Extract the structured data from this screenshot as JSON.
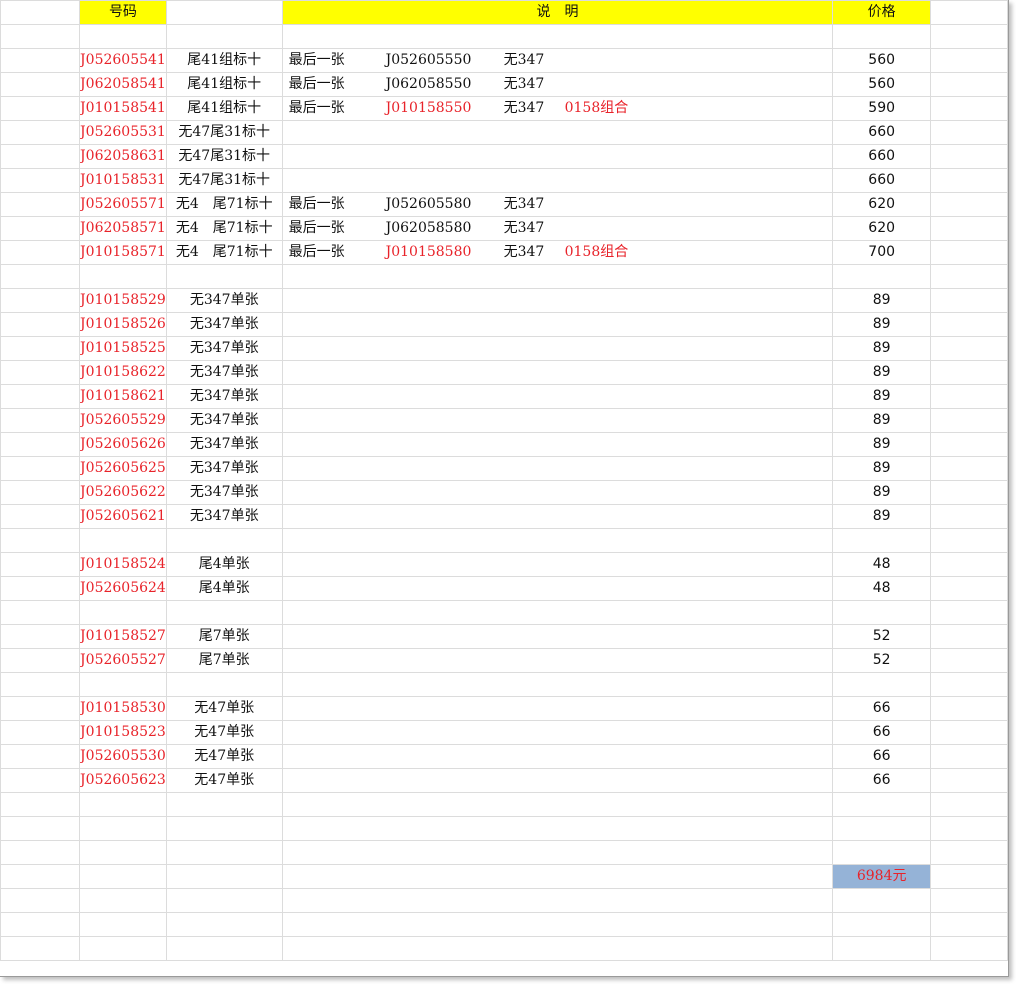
{
  "headers": {
    "code": "号码",
    "note": "说　明",
    "price": "价格"
  },
  "rows": [
    {
      "type": "blank"
    },
    {
      "type": "item",
      "code": "J052605541",
      "desc": "尾41组标十",
      "note1": "最后一张",
      "note2": "J052605550",
      "note3": "无347",
      "price": "560"
    },
    {
      "type": "item",
      "code": "J062058541",
      "desc": "尾41组标十",
      "note1": "最后一张",
      "note2": "J062058550",
      "note3": "无347",
      "price": "560"
    },
    {
      "type": "item",
      "code": "J010158541",
      "desc": "尾41组标十",
      "note1": "最后一张",
      "note2": "J010158550",
      "note3": "无347",
      "note4": "0158组合",
      "note2_red": true,
      "price": "590"
    },
    {
      "type": "item",
      "code": "J052605531",
      "desc": "无47尾31标十",
      "price": "660"
    },
    {
      "type": "item",
      "code": "J062058631",
      "desc": "无47尾31标十",
      "price": "660"
    },
    {
      "type": "item",
      "code": "J010158531",
      "desc": "无47尾31标十",
      "price": "660"
    },
    {
      "type": "item",
      "code": "J052605571",
      "desc": "无4　尾71标十",
      "note1": "最后一张",
      "note2": "J052605580",
      "note3": "无347",
      "price": "620"
    },
    {
      "type": "item",
      "code": "J062058571",
      "desc": "无4　尾71标十",
      "note1": "最后一张",
      "note2": "J062058580",
      "note3": "无347",
      "price": "620"
    },
    {
      "type": "item",
      "code": "J010158571",
      "desc": "无4　尾71标十",
      "note1": "最后一张",
      "note2": "J010158580",
      "note3": "无347",
      "note4": "0158组合",
      "note2_red": true,
      "price": "700"
    },
    {
      "type": "blank"
    },
    {
      "type": "item",
      "code": "J010158529",
      "desc": "无347单张",
      "price": "89"
    },
    {
      "type": "item",
      "code": "J010158526",
      "desc": "无347单张",
      "price": "89"
    },
    {
      "type": "item",
      "code": "J010158525",
      "desc": "无347单张",
      "price": "89"
    },
    {
      "type": "item",
      "code": "J010158622",
      "desc": "无347单张",
      "price": "89"
    },
    {
      "type": "item",
      "code": "J010158621",
      "desc": "无347单张",
      "price": "89"
    },
    {
      "type": "item",
      "code": "J052605529",
      "desc": "无347单张",
      "price": "89"
    },
    {
      "type": "item",
      "code": "J052605626",
      "desc": "无347单张",
      "price": "89"
    },
    {
      "type": "item",
      "code": "J052605625",
      "desc": "无347单张",
      "price": "89"
    },
    {
      "type": "item",
      "code": "J052605622",
      "desc": "无347单张",
      "price": "89"
    },
    {
      "type": "item",
      "code": "J052605621",
      "desc": "无347单张",
      "price": "89"
    },
    {
      "type": "blank"
    },
    {
      "type": "item",
      "code": "J010158524",
      "desc": "尾4单张",
      "price": "48"
    },
    {
      "type": "item",
      "code": "J052605624",
      "desc": "尾4单张",
      "price": "48"
    },
    {
      "type": "blank"
    },
    {
      "type": "item",
      "code": "J010158527",
      "desc": "尾7单张",
      "price": "52"
    },
    {
      "type": "item",
      "code": "J052605527",
      "desc": "尾7单张",
      "price": "52"
    },
    {
      "type": "blank"
    },
    {
      "type": "item",
      "code": "J010158530",
      "desc": "无47单张",
      "price": "66"
    },
    {
      "type": "item",
      "code": "J010158523",
      "desc": "无47单张",
      "price": "66"
    },
    {
      "type": "item",
      "code": "J052605530",
      "desc": "无47单张",
      "price": "66"
    },
    {
      "type": "item",
      "code": "J052605623",
      "desc": "无47单张",
      "price": "66"
    },
    {
      "type": "blank"
    },
    {
      "type": "blank"
    },
    {
      "type": "blank"
    },
    {
      "type": "total",
      "price": "6984元"
    },
    {
      "type": "blank"
    },
    {
      "type": "blank"
    },
    {
      "type": "blank"
    }
  ],
  "colors": {
    "header_bg": "#ffff00",
    "code_text": "#e8232a",
    "total_bg": "#95b3d7",
    "grid": "#dcdcdc"
  }
}
